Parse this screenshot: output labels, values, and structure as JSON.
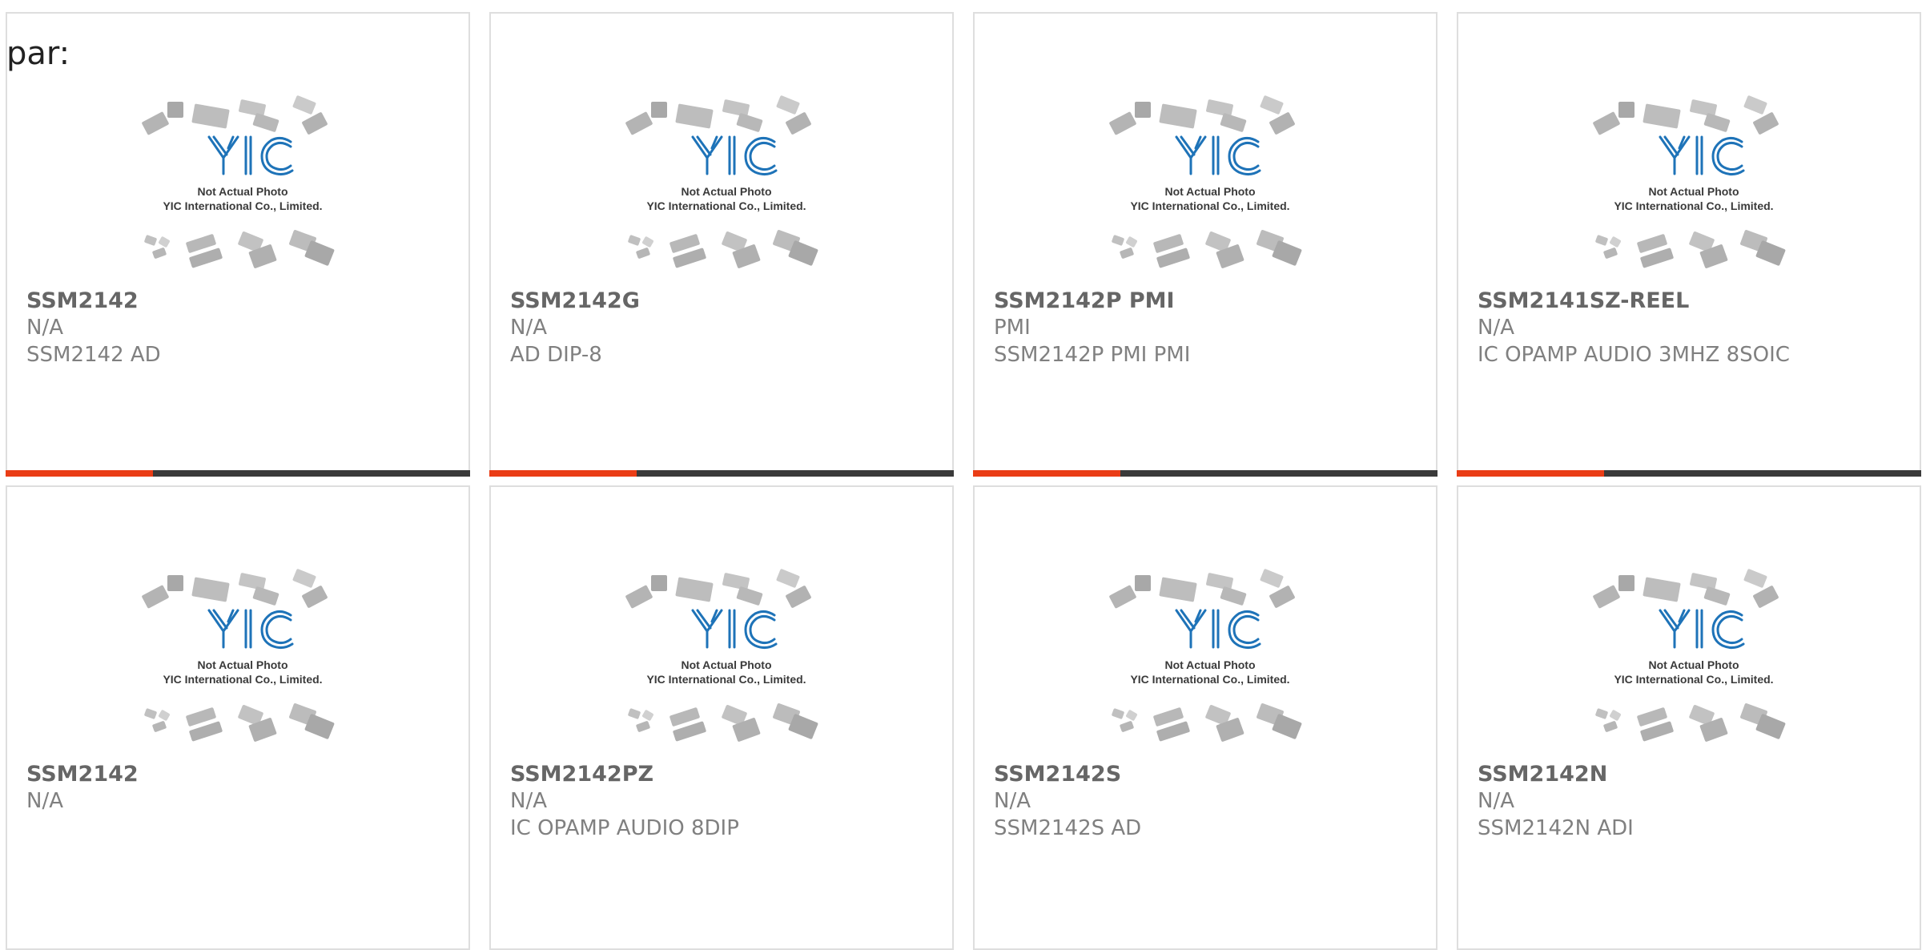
{
  "leading_text": "par:",
  "accent_color": "#ea3d16",
  "bar_color": "#3a3a3a",
  "placeholder_image": {
    "line1": "Not Actual Photo",
    "line2": "YIC International Co., Limited.",
    "logo_text": "YIC",
    "logo_color": "#1e73b8"
  },
  "products": [
    {
      "name": "SSM2142",
      "manufacturer": "N/A",
      "description": "SSM2142 AD"
    },
    {
      "name": "SSM2142G",
      "manufacturer": "N/A",
      "description": "AD DIP-8"
    },
    {
      "name": "SSM2142P PMI",
      "manufacturer": "PMI",
      "description": "SSM2142P PMI PMI"
    },
    {
      "name": "SSM2141SZ-REEL",
      "manufacturer": "N/A",
      "description": "IC OPAMP AUDIO 3MHZ 8SOIC"
    },
    {
      "name": "SSM2142",
      "manufacturer": "N/A",
      "description": ""
    },
    {
      "name": "SSM2142PZ",
      "manufacturer": "N/A",
      "description": "IC OPAMP AUDIO 8DIP"
    },
    {
      "name": "SSM2142S",
      "manufacturer": "N/A",
      "description": "SSM2142S AD"
    },
    {
      "name": "SSM2142N",
      "manufacturer": "N/A",
      "description": "SSM2142N ADI"
    }
  ]
}
